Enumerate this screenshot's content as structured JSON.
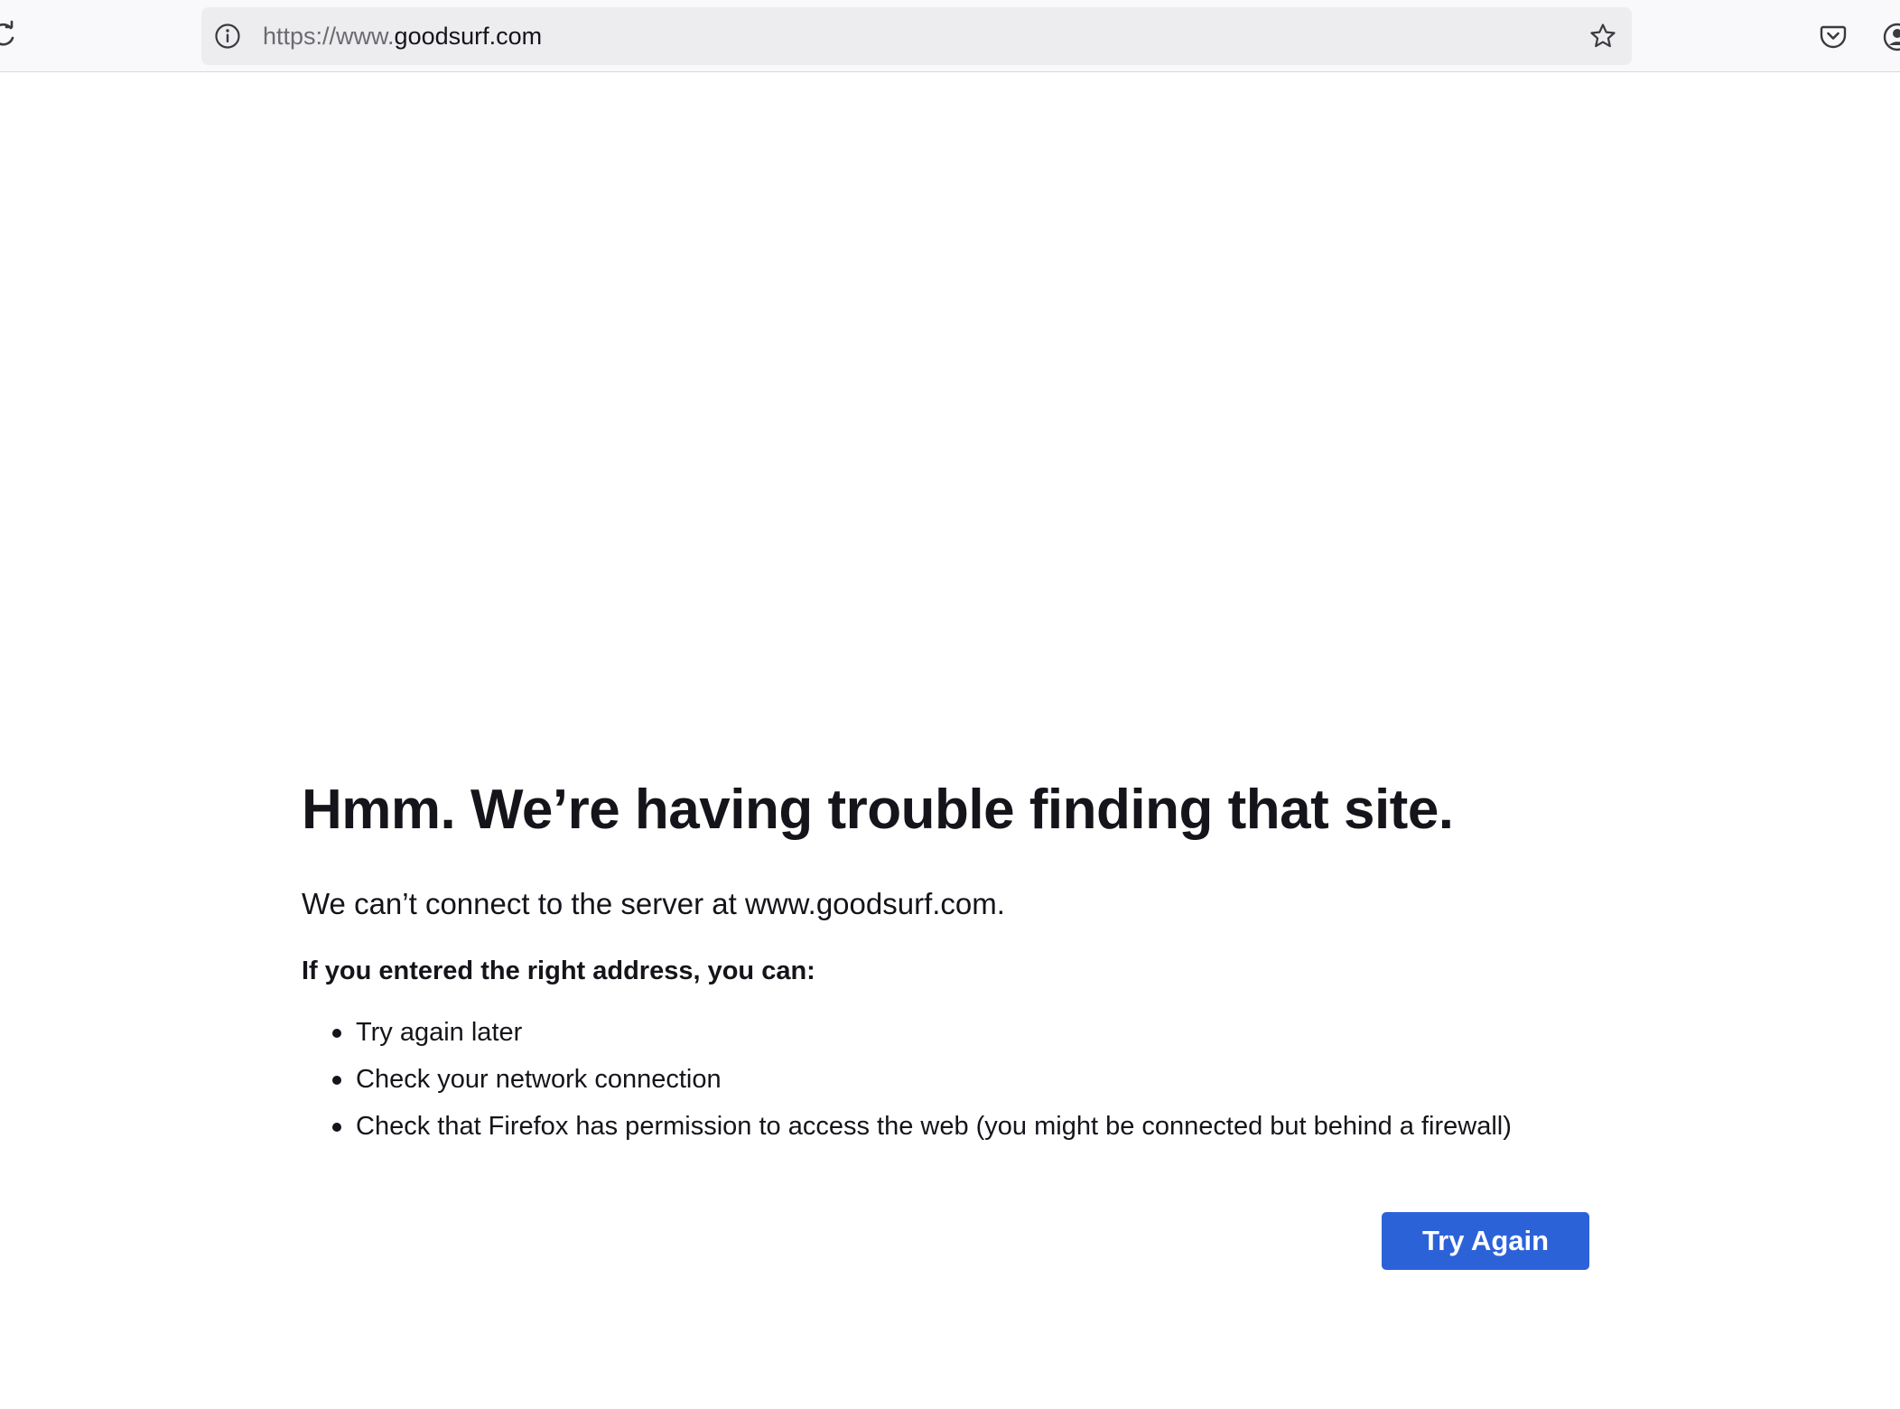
{
  "browser": {
    "url_prefix": "https://www.",
    "url_domain": "goodsurf.com",
    "icons": {
      "reload": "reload-icon",
      "site_info": "info-icon",
      "bookmark": "star-icon",
      "pocket": "pocket-icon",
      "account": "account-icon"
    }
  },
  "error_page": {
    "title": "Hmm. We’re having trouble finding that site.",
    "description": "We can’t connect to the server at www.goodsurf.com.",
    "suggestions_heading": "If you entered the right address, you can:",
    "suggestions": [
      "Try again later",
      "Check your network connection",
      "Check that Firefox has permission to access the web (you might be connected but behind a firewall)"
    ],
    "try_again_label": "Try Again"
  },
  "colors": {
    "accent": "#2c62d8",
    "toolbar_bg": "#f9f9fb",
    "urlbar_bg": "#ededf0",
    "text": "#15141a"
  }
}
